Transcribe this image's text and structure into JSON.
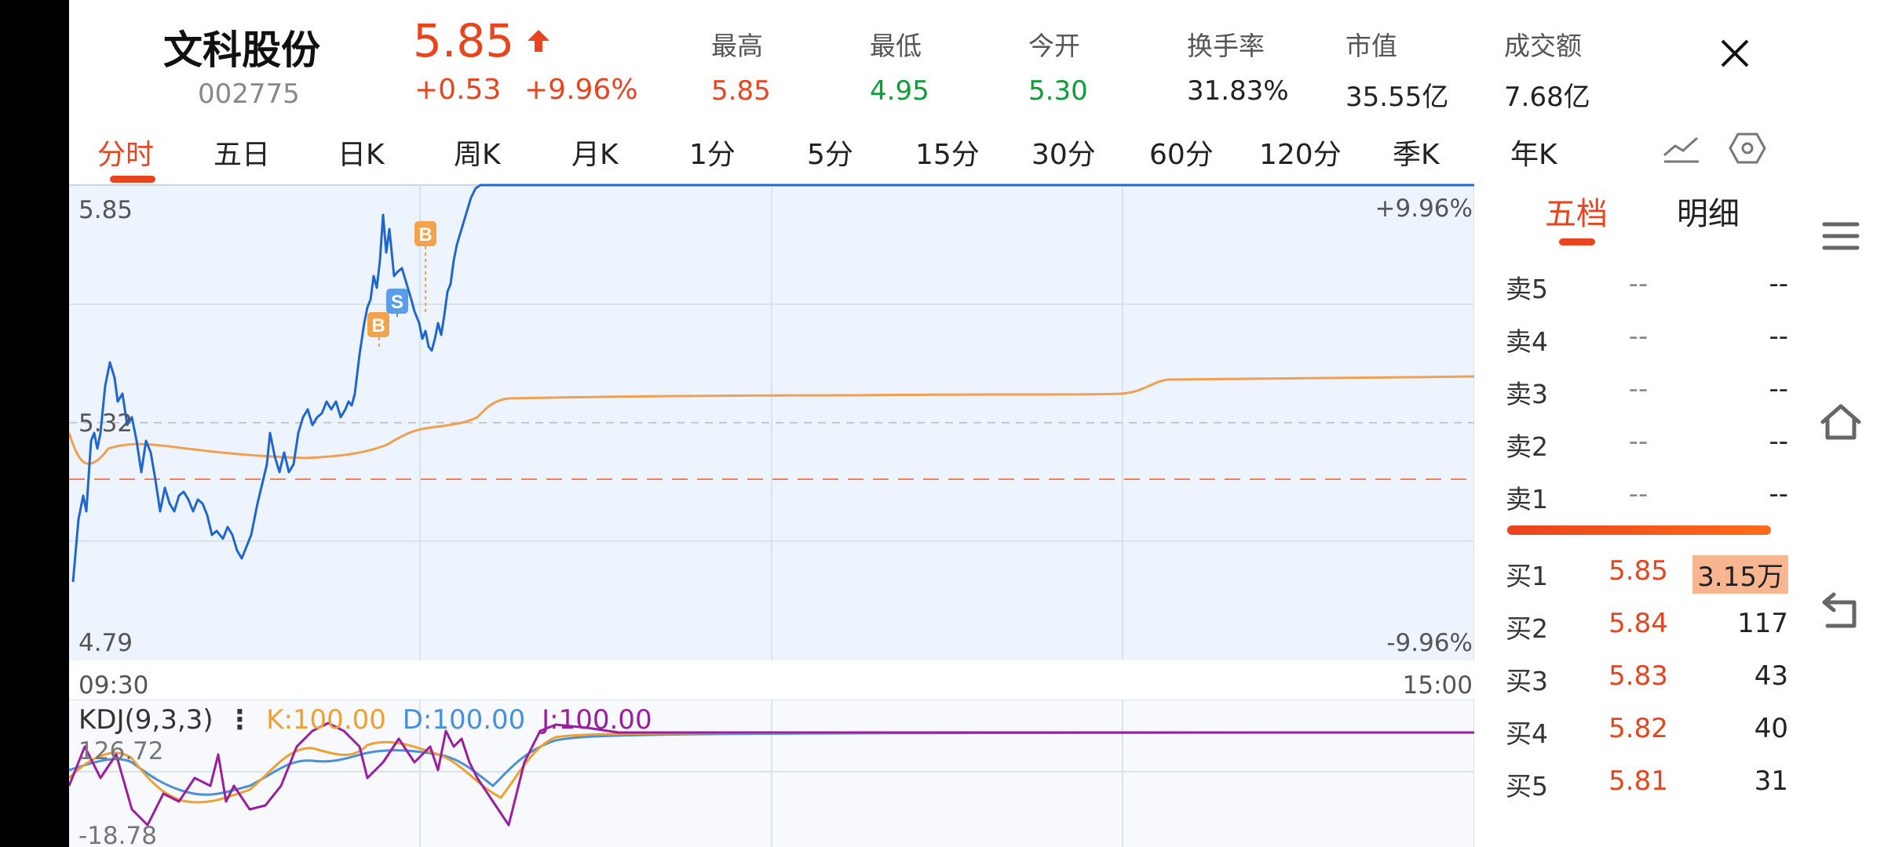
{
  "stock": {
    "name": "文科股份",
    "code": "002775",
    "price": "5.85",
    "change": "+0.53",
    "change_pct": "+9.96%"
  },
  "stats": [
    {
      "label": "最高",
      "value": "5.85",
      "tone": "red"
    },
    {
      "label": "最低",
      "value": "4.95",
      "tone": "green"
    },
    {
      "label": "今开",
      "value": "5.30",
      "tone": "green"
    },
    {
      "label": "换手率",
      "value": "31.83%",
      "tone": "dark"
    },
    {
      "label": "市值",
      "value": "35.55亿",
      "tone": "dark"
    },
    {
      "label": "成交额",
      "value": "7.68亿",
      "tone": "dark"
    }
  ],
  "tabs": [
    "分时",
    "五日",
    "日K",
    "周K",
    "月K",
    "1分",
    "5分",
    "15分",
    "30分",
    "60分",
    "120分",
    "季K",
    "年K"
  ],
  "active_tab": "分时",
  "chart": {
    "y_top": "5.85",
    "y_mid": "5.32",
    "y_bottom": "4.79",
    "pct_top": "+9.96%",
    "pct_bottom": "-9.96%",
    "time_start": "09:30",
    "time_end": "15:00",
    "markers": [
      "B",
      "S",
      "B"
    ]
  },
  "kdj": {
    "title": "KDJ(9,3,3)",
    "k": "K:100.00",
    "d": "D:100.00",
    "j": "J:100.00",
    "y_top": "126.72",
    "y_bottom": "-18.78"
  },
  "orderbook": {
    "tabs": [
      "五档",
      "明细"
    ],
    "sell": [
      {
        "label": "卖5",
        "price": "--",
        "vol": "--"
      },
      {
        "label": "卖4",
        "price": "--",
        "vol": "--"
      },
      {
        "label": "卖3",
        "price": "--",
        "vol": "--"
      },
      {
        "label": "卖2",
        "price": "--",
        "vol": "--"
      },
      {
        "label": "卖1",
        "price": "--",
        "vol": "--"
      }
    ],
    "buy": [
      {
        "label": "买1",
        "price": "5.85",
        "vol": "3.15万"
      },
      {
        "label": "买2",
        "price": "5.84",
        "vol": "117"
      },
      {
        "label": "买3",
        "price": "5.83",
        "vol": "43"
      },
      {
        "label": "买4",
        "price": "5.82",
        "vol": "40"
      },
      {
        "label": "买5",
        "price": "5.81",
        "vol": "31"
      }
    ]
  },
  "colors": {
    "up": "#e8441d",
    "down": "#0f9d3a",
    "price_line": "#1f66d1",
    "avg_line": "#f0a050",
    "k_line": "#f0a030",
    "d_line": "#4a90d9",
    "j_line": "#9b1ea0"
  },
  "icons": {
    "close": "close-icon",
    "line_style": "line-chart-icon",
    "settings": "hexagon-settings-icon",
    "menu": "menu-icon",
    "home": "home-icon",
    "back": "back-icon"
  }
}
